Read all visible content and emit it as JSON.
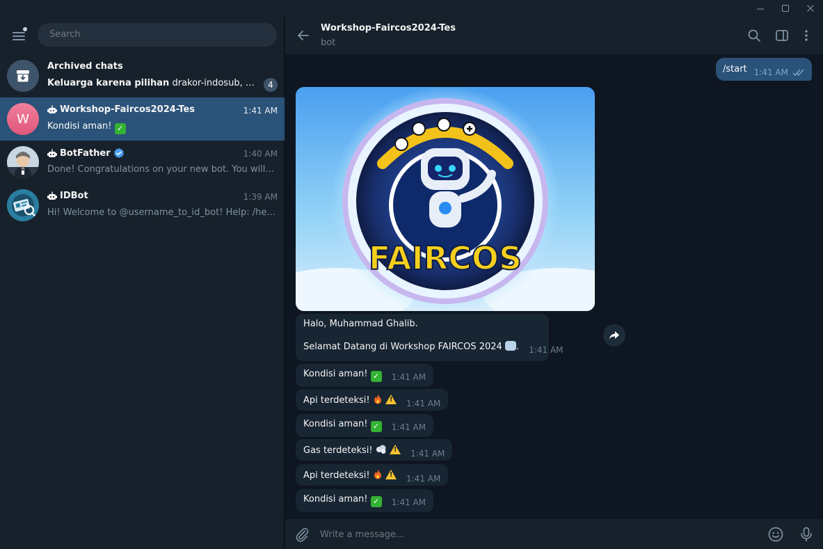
{
  "window": {
    "minimize_icon": "minimize-icon",
    "maximize_icon": "maximize-icon",
    "close_icon": "close-icon"
  },
  "sidebar": {
    "search_placeholder": "Search",
    "archived": {
      "title": "Archived chats",
      "preview_bold": "Keluarga karena pilihan",
      "preview_rest": "drakor-indosub, Tik To...",
      "unread": "4"
    },
    "chats": [
      {
        "name": "Workshop-Faircos2024-Tes",
        "time": "1:41 AM",
        "preview": "Kondisi aman!",
        "avatar_letter": "W",
        "avatar_color": "#e36685",
        "is_bot": true,
        "active": true
      },
      {
        "name": "BotFather",
        "time": "1:40 AM",
        "preview": "Done! Congratulations on your new bot. You will find it at t.me/",
        "is_bot": true,
        "verified": true
      },
      {
        "name": "IDBot",
        "time": "1:39 AM",
        "preview": "Hi! Welcome to @username_to_id_bot!  Help: /help  Bot ID",
        "is_bot": true
      }
    ]
  },
  "header": {
    "title": "Workshop-Faircos2024-Tes",
    "subtitle": "bot"
  },
  "messages": {
    "outgoing": {
      "text": "/start",
      "time": "1:41 AM"
    },
    "photo_logo_text": "FAIRCOS",
    "welcome_line1": "Halo, Muhammad Ghalib.",
    "welcome_line2": "Selamat Datang di Workshop FAIRCOS 2024",
    "welcome_time": "1:41 AM",
    "status": [
      {
        "text": "Kondisi aman!",
        "time": "1:41 AM"
      },
      {
        "text": "Api terdeteksi!",
        "time": "1:41 AM"
      },
      {
        "text": "Kondisi aman!",
        "time": "1:41 AM"
      },
      {
        "text": "Gas terdeteksi!",
        "time": "1:41 AM"
      },
      {
        "text": "Api terdeteksi!",
        "time": "1:41 AM"
      },
      {
        "text": "Kondisi aman!",
        "time": "1:41 AM"
      }
    ]
  },
  "composer": {
    "placeholder": "Write a message..."
  },
  "colors": {
    "background": "#0e1621",
    "panel": "#17212b",
    "active_row": "#2b5278",
    "incoming_bubble": "#182533",
    "outgoing_bubble": "#2b5278"
  }
}
